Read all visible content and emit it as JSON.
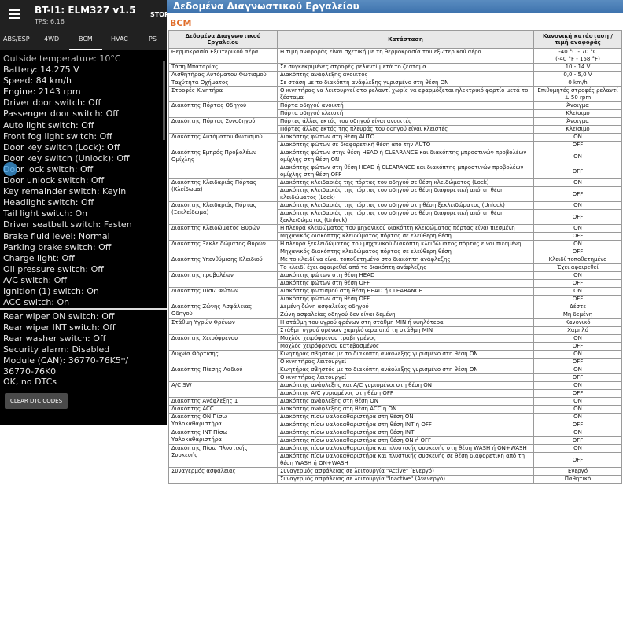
{
  "app": {
    "title": "BT-I1: ELM327 v1.5",
    "subtitle": "TPS: 6.16",
    "stop_label": "STOP",
    "tabs": [
      "ABS/ESP",
      "4WD",
      "BCM",
      "HVAC",
      "PS"
    ],
    "live": [
      "Outside temperature: 10°C",
      "Battery: 14.275 V",
      "Speed: 84 km/h",
      "Engine: 2143 rpm",
      "Driver door switch: Off",
      "Passenger door switch: Off",
      "Auto light switch: Off",
      "Front fog light switch: Off",
      "Door key switch (Lock): Off",
      "Door key switch (Unlock): Off",
      "Door lock switch: Off",
      "Door unlock switch: Off",
      "Key remainder switch: KeyIn",
      "Headlight switch: Off",
      "Tail light switch: On",
      "Driver seatbelt switch: Fasten",
      "Brake fluid level: Normal",
      "Parking brake switch: Off",
      "Charge light: Off",
      "Oil pressure switch: Off",
      "A/C switch: Off",
      "Ignition (1) switch: On",
      "ACC switch: On"
    ],
    "dtc": [
      "Rear wiper ON switch: Off",
      "Rear wiper INT switch: Off",
      "Rear washer switch: Off",
      "Security alarm: Disabled",
      "Module (CAN): 36770-76K5*/",
      "36770-76K0",
      "OK, no DTCs"
    ],
    "clear_button": "CLEAR DTC CODES"
  },
  "manual": {
    "title": "Δεδομένα Διαγνωστικού Εργαλείου",
    "section": "BCM",
    "headers": [
      "Δεδομένα Διαγνωστικού Εργαλείου",
      "Κατάσταση",
      "Κανονική κατάσταση / τιμή αναφοράς"
    ],
    "rows": [
      {
        "name": "Θερμοκρασία Εξωτερικού αέρα",
        "conds": [
          [
            "Η τιμή αναφοράς είναι σχετική με τη θερμοκρασία του εξωτερικού αέρα",
            "-40 °C - 70 °C\n(-40 °F - 158 °F)"
          ]
        ]
      },
      {
        "name": "Τάση Μπαταρίας",
        "conds": [
          [
            "Σε συγκεκριμένες στροφές ρελαντί μετά το ζέσταμα",
            "10 - 14 V"
          ]
        ]
      },
      {
        "name": "Αισθητήρας Αυτόματου Φωτισμού",
        "conds": [
          [
            "Διακόπτης ανάφλεξης ανοικτός",
            "0,0 - 5,0 V"
          ]
        ]
      },
      {
        "name": "Ταχύτητα Οχήματος",
        "conds": [
          [
            "Σε στάση με το διακόπτη ανάφλεξης γυρισμένο στη θέση ON",
            "0 km/h"
          ]
        ]
      },
      {
        "name": "Στροφές Κινητήρα",
        "conds": [
          [
            "Ο κινητήρας να λειτουργεί στο ρελαντί χωρίς να εφαρμόζεται ηλεκτρικό φορτίο μετά το ζέσταμα",
            "Επιθυμητές στροφές ρελαντί ± 50 rpm"
          ]
        ]
      },
      {
        "name": "Διακόπτης Πόρτας Οδηγού",
        "conds": [
          [
            "Πόρτα οδηγού ανοικτή",
            "Άνοιγμα"
          ],
          [
            "Πόρτα οδηγού κλειστή",
            "Κλείσιμο"
          ]
        ]
      },
      {
        "name": "Διακόπτης Πόρτας Συνοδηγού",
        "conds": [
          [
            "Πόρτες άλλες εκτός του οδηγού είναι ανοικτές",
            "Άνοιγμα"
          ],
          [
            "Πόρτες άλλες εκτός της πλευράς του οδηγού είναι κλειστές",
            "Κλείσιμο"
          ]
        ]
      },
      {
        "name": "Διακόπτης Αυτόματου Φωτισμού",
        "conds": [
          [
            "Διακόπτης φώτων στη θέση AUTO",
            "ON"
          ],
          [
            "Διακόπτης φώτων σε διαφορετική θέση από την AUTO",
            "OFF"
          ]
        ]
      },
      {
        "name": "Διακόπτης Εμπρός Προβολέων Ομίχλης",
        "conds": [
          [
            "Διακόπτης φώτων στην θέση HEAD ή CLEARANCE και διακόπτης μπροστινών προβολέων ομίχλης στη θέση ON",
            "ON"
          ],
          [
            "Διακόπτης φώτων στη θέση HEAD ή CLEARANCE και διακόπτης μπροστινών προβολέων ομίχλης στη θέση OFF",
            "OFF"
          ]
        ]
      },
      {
        "name": "Διακόπτης Κλειδαριάς Πόρτας (Κλείδωμα)",
        "conds": [
          [
            "Διακόπτης κλειδαριάς της πόρτας του οδηγού σε θέση κλειδώματος (Lock)",
            "ON"
          ],
          [
            "Διακόπτης κλειδαριάς της πόρτας του οδηγού σε θέση διαφορετική από τη θέση κλειδώματος (Lock)",
            "OFF"
          ]
        ]
      },
      {
        "name": "Διακόπτης Κλειδαριάς Πόρτας (Ξεκλείδωμα)",
        "conds": [
          [
            "Διακόπτης κλειδαριάς της πόρτας του οδηγού στη θέση ξεκλειδώματος (Unlock)",
            "ON"
          ],
          [
            "Διακόπτης κλειδαριάς της πόρτας του οδηγού σε θέση διαφορετική από τη θέση ξεκλειδώματος (Unlock)",
            "OFF"
          ]
        ]
      },
      {
        "name": "Διακόπτης Κλειδώματος Θυρών",
        "conds": [
          [
            "Η πλευρά κλειδώματος του μηχανικού διακόπτη κλειδώματος πόρτας είναι πιεσμένη",
            "ON"
          ],
          [
            "Μηχανικός διακόπτης κλειδώματος πόρτας σε ελεύθερη θέση",
            "OFF"
          ]
        ]
      },
      {
        "name": "Διακόπτης Ξεκλειδώματος Θυρών",
        "conds": [
          [
            "Η πλευρά ξεκλειδώματος του μηχανικού διακόπτη κλειδώματος πόρτας είναι πιεσμένη",
            "ON"
          ],
          [
            "Μηχανικός διακόπτης κλειδώματος πόρτας σε ελεύθερη θέση",
            "OFF"
          ]
        ]
      },
      {
        "name": "Διακόπτης Υπενθύμισης Κλειδιού",
        "conds": [
          [
            "Με το κλειδί να είναι τοποθετημένο στο διακόπτη ανάφλεξης",
            "Κλειδί τοποθετημένο"
          ],
          [
            "Το κλειδί έχει αφαιρεθεί από το διακόπτη ανάφλεξης",
            "Έχει αφαιρεθεί"
          ]
        ]
      },
      {
        "name": "Διακόπτης προβολέων",
        "conds": [
          [
            "Διακόπτης φώτων στη θέση HEAD",
            "ON"
          ],
          [
            "Διακόπτης φώτων στη θέση OFF",
            "OFF"
          ]
        ]
      },
      {
        "name": "Διακόπτης Πίσω Φώτων",
        "conds": [
          [
            "Διακόπτης φωτισμού στη θέση HEAD ή CLEARANCE",
            "ON"
          ],
          [
            "Διακόπτης φώτων στη θέση OFF",
            "OFF"
          ]
        ]
      },
      {
        "name": "Διακόπτης Ζώνης Ασφάλειας Οδηγού",
        "conds": [
          [
            "Δεμένη ζώνη ασφαλείας οδηγού",
            "Δέστε"
          ],
          [
            "Ζώνη ασφαλείας οδηγού δεν είναι δεμένη",
            "Μη δεμένη"
          ]
        ]
      },
      {
        "name": "Στάθμη Υγρών Φρένων",
        "conds": [
          [
            "Η στάθμη του υγρού φρένων στη στάθμη MIN ή υψηλότερα",
            "Κανονικό"
          ],
          [
            "Στάθμη υγρού φρένων χαμηλότερα από τη στάθμη MIN",
            "Χαμηλό"
          ]
        ]
      },
      {
        "name": "Διακόπτης Χειρόφρενου",
        "conds": [
          [
            "Μοχλός χειρόφρενου τραβηγμένος",
            "ON"
          ],
          [
            "Μοχλός χειρόφρενου κατεβασμένος",
            "OFF"
          ]
        ]
      },
      {
        "name": "Λυχνία Φόρτισης",
        "conds": [
          [
            "Κινητήρας σβηστός με το διακόπτη ανάφλεξης γυρισμένο στη θέση ON",
            "ON"
          ],
          [
            "Ο κινητήρας λειτουργεί",
            "OFF"
          ]
        ]
      },
      {
        "name": "Διακόπτης Πίεσης Λαδιού",
        "conds": [
          [
            "Κινητήρας σβηστός με το διακόπτη ανάφλεξης γυρισμένο στη θέση ON",
            "ON"
          ],
          [
            "Ο κινητήρας λειτουργεί",
            "OFF"
          ]
        ]
      },
      {
        "name": "A/C SW",
        "conds": [
          [
            "Διακόπτης ανάφλεξης και A/C γυρισμένοι στη θέση ON",
            "ON"
          ],
          [
            "Διακόπτης A/C γυρισμένος στη θέση OFF",
            "OFF"
          ]
        ]
      },
      {
        "name": "Διακόπτης Ανάφλεξης 1",
        "conds": [
          [
            "Διακόπτης ανάφλεξης στη θέση ON",
            "ON"
          ]
        ]
      },
      {
        "name": "Διακόπτης ACC",
        "conds": [
          [
            "Διακόπτης ανάφλεξης στη θέση ACC ή ON",
            "ON"
          ]
        ]
      },
      {
        "name": "Διακόπτης ON Πίσω Υαλοκαθαριστήρα",
        "conds": [
          [
            "Διακόπτης πίσω υαλοκαθαριστήρα στη θέση ON",
            "ON"
          ],
          [
            "Διακόπτης πίσω υαλοκαθαριστήρα στη θέση INT ή OFF",
            "OFF"
          ]
        ]
      },
      {
        "name": "Διακόπτης INT Πίσω Υαλοκαθαριστήρα",
        "conds": [
          [
            "Διακόπτης πίσω υαλοκαθαριστήρα στη θέση INT",
            "ON"
          ],
          [
            "Διακόπτης πίσω υαλοκαθαριστήρα στη θέση ON ή OFF",
            "OFF"
          ]
        ]
      },
      {
        "name": "Διακόπτης Πίσω Πλυστικής Συσκευής",
        "conds": [
          [
            "Διακόπτης πίσω υαλοκαθαριστήρα και πλυστικής συσκευής στη θέση WASH ή ON+WASH",
            "ON"
          ],
          [
            "Διακόπτης πίσω υαλοκαθαριστήρα και πλυστικής συσκευής σε θέση διαφορετική από τη θέση WASH ή ON+WASH",
            "OFF"
          ]
        ]
      },
      {
        "name": "Συναγερμός ασφάλειας",
        "conds": [
          [
            "Συναγερμός ασφάλειας σε λειτουργία \"Active\" (Ενεργό)",
            "Ενεργό"
          ],
          [
            "Συναγερμός ασφάλειας σε λειτουργία \"Inactive\" (Ανενεργό)",
            "Παθητικό"
          ]
        ]
      }
    ]
  }
}
